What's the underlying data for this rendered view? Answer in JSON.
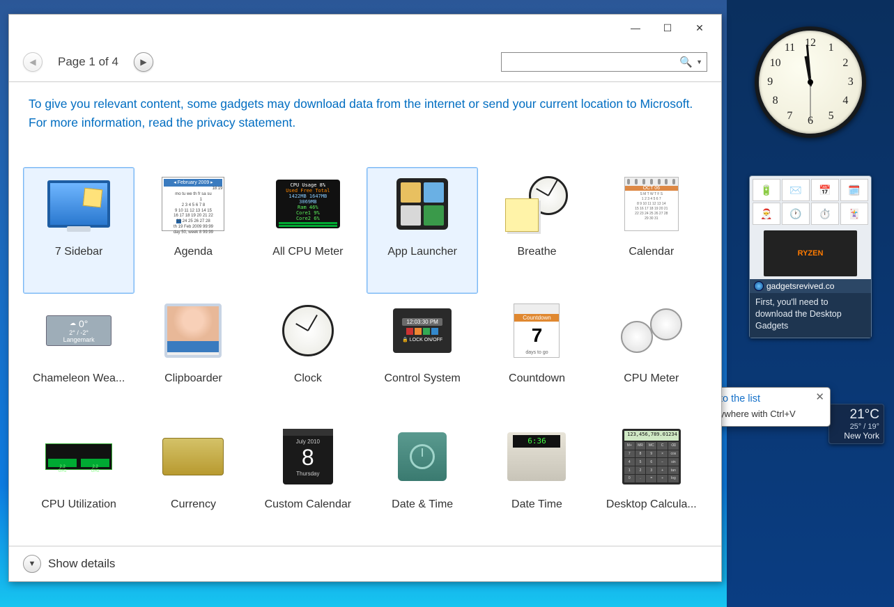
{
  "toolbar": {
    "page_label": "Page 1 of 4",
    "search_placeholder": ""
  },
  "notice": "To give you relevant content, some gadgets may download data from the internet or send your current location to Microsoft. For more information, read the privacy statement.",
  "gadgets": {
    "r0c0": {
      "label": "7 Sidebar",
      "selected": true
    },
    "r0c1": {
      "label": "Agenda",
      "cal_header": "◂ February 2009 ▸",
      "cal_time": "18:19",
      "cal_footer1": "th 19 Feb 2009   99:99",
      "cal_footer2": "day 50, week 8   99:99"
    },
    "r0c2": {
      "label": "All CPU Meter",
      "cpu_title": "CPU Usage  8%",
      "cpu_l1": "Used  Free  Total",
      "cpu_l2": "1422MB 1647MB 3069MB",
      "cpu_l3": "Ram 46%",
      "cpu_l4": "Core1 9%",
      "cpu_l5": "Core2 6%"
    },
    "r0c3": {
      "label": "App Launcher",
      "selected": true
    },
    "r0c4": {
      "label": "Breathe"
    },
    "r0c5": {
      "label": "Calendar",
      "cal_hdr": "OCT 06"
    },
    "r1c0": {
      "label": "Chameleon Wea...",
      "w_temp": "0°",
      "w_range": "2° / -2°",
      "w_city": "Langemark"
    },
    "r1c1": {
      "label": "Clipboarder"
    },
    "r1c2": {
      "label": "Clock"
    },
    "r1c3": {
      "label": "Control System",
      "lock_time": "12:03:30 PM",
      "lock_label": "🔒 LOCK ON/OFF"
    },
    "r1c4": {
      "label": "Countdown",
      "cd_hdr": "Countdown",
      "cd_num": "7",
      "cd_ft": "days to go"
    },
    "r1c5": {
      "label": "CPU Meter"
    },
    "r2c0": {
      "label": "CPU Utilization",
      "ghz": "2.2 GHz"
    },
    "r2c1": {
      "label": "Currency"
    },
    "r2c2": {
      "label": "Custom Calendar",
      "cc_month": "July 2010",
      "cc_day": "8",
      "cc_wd": "Thursday"
    },
    "r2c3": {
      "label": "Date & Time"
    },
    "r2c4": {
      "label": "Date Time",
      "oven": "6:36"
    },
    "r2c5": {
      "label": "Desktop Calcula...",
      "calc_disp": "123,456,789.01234"
    }
  },
  "footer": {
    "show_details": "Show details"
  },
  "clock": {
    "numbers": [
      "12",
      "1",
      "2",
      "3",
      "4",
      "5",
      "6",
      "7",
      "8",
      "9",
      "10",
      "11"
    ]
  },
  "feed": {
    "icon_captions": [
      "Battery",
      "Folder Login",
      "Calendar",
      "Calendar",
      "Christmas",
      "Clock",
      "Stopwatch and Timers",
      "Fun and Games"
    ],
    "img_text": "RYZEN",
    "title": "gadgetsrevived.co",
    "text": "First, you'll need to download the Desktop Gadgets"
  },
  "tooltip": {
    "title": "to the list",
    "sub": "ywhere with Ctrl+V"
  },
  "weather": {
    "temp": "21°C",
    "range": "25° / 19°",
    "city": "New York"
  }
}
